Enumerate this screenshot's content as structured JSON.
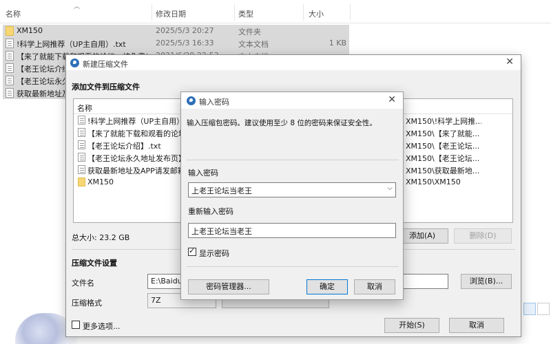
{
  "explorer": {
    "columns": {
      "name": "名称",
      "date": "修改日期",
      "type": "类型",
      "size": "大小"
    },
    "rows": [
      {
        "icon": "folder-icon",
        "name": "XM150",
        "date": "2025/5/3 20:27",
        "type": "文件夹",
        "size": ""
      },
      {
        "icon": "file-icon",
        "name": "!科学上网推荐（UP主自用）.txt",
        "date": "2025/5/3 16:33",
        "type": "文本文档",
        "size": "1 KB"
      },
      {
        "icon": "file-icon",
        "name": "【来了就能下载和观看的论坛，纯免费！",
        "date": "2021/6/29 22:53",
        "type": "文本文档",
        "size": ""
      },
      {
        "icon": "file-icon",
        "name": "【老王论坛介绍】",
        "date": "",
        "type": "",
        "size": ""
      },
      {
        "icon": "file-icon",
        "name": "【老王论坛永久",
        "date": "",
        "type": "",
        "size": ""
      },
      {
        "icon": "file-icon",
        "name": "获取最新地址及",
        "date": "",
        "type": "",
        "size": ""
      }
    ]
  },
  "archive_dialog": {
    "title": "新建压缩文件",
    "add_section": "添加文件到压缩文件",
    "list_header": "名称",
    "files": [
      {
        "icon": "file-icon",
        "name": "!科学上网推荐（UP主自用）.txt",
        "path": "XM150\\!科学上网推..."
      },
      {
        "icon": "file-icon",
        "name": "【来了就能下载和观看的论坛，",
        "path": "XM150\\【来了就能..."
      },
      {
        "icon": "file-icon",
        "name": "【老王论坛介绍】.txt",
        "path": "XM150\\【老王论坛..."
      },
      {
        "icon": "file-icon",
        "name": "【老王论坛永久地址发布页】.t",
        "path": "XM150\\【老王论坛..."
      },
      {
        "icon": "file-icon",
        "name": "获取最新地址及APP请发邮箱自",
        "path": "XM150\\获取最新地..."
      },
      {
        "icon": "folder-icon",
        "name": "XM150",
        "path": "XM150\\XM150"
      }
    ],
    "total_size": "总大小: 23.2 GB",
    "add_button": "添加(A)",
    "delete_button": "删除(D)",
    "settings_section": "压缩文件设置",
    "filename_label": "文件名",
    "filename_value": "E:\\BaiduN",
    "browse_button": "浏览(B)...",
    "format_label": "压缩格式",
    "format_value": "7Z",
    "more_options": "更多选项...",
    "start_button": "开始(S)",
    "cancel_button": "取消"
  },
  "password_dialog": {
    "title": "输入密码",
    "instruction": "输入压缩包密码。建议使用至少 8 位的密码来保证安全性。",
    "password_label": "输入密码",
    "password_value": "上老王论坛当老王",
    "confirm_label": "重新输入密码",
    "confirm_value": "上老王论坛当老王",
    "show_password": "显示密码",
    "show_password_checked": true,
    "manager_button": "密码管理器...",
    "ok_button": "确定",
    "cancel_button": "取消"
  }
}
